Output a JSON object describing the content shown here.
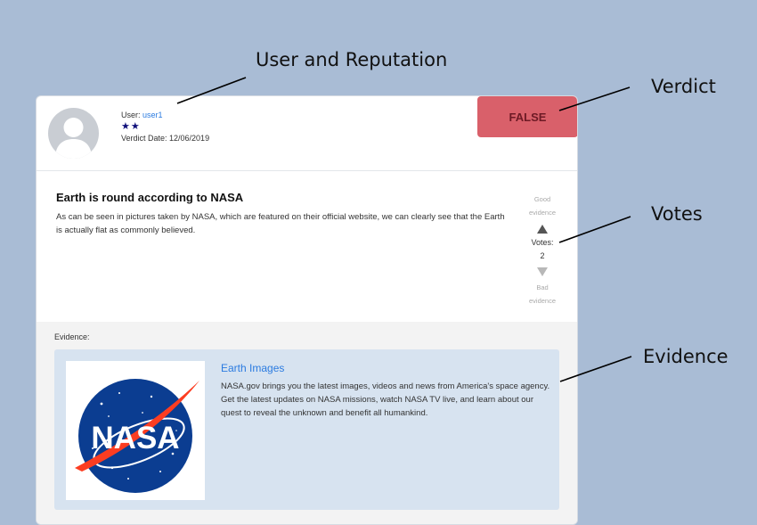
{
  "callouts": {
    "user_reputation": "User and Reputation",
    "verdict": "Verdict",
    "votes": "Votes",
    "evidence": "Evidence"
  },
  "header": {
    "user_label": "User:",
    "username": "user1",
    "stars": "★★",
    "verdict_date": "Verdict Date: 12/06/2019",
    "verdict": "FALSE"
  },
  "claim": {
    "title": "Earth is round according to NASA",
    "body": "As can be seen in pictures taken by NASA, which are featured on their official website, we can clearly see that the Earth is actually flat as commonly believed."
  },
  "votes": {
    "good_line1": "Good",
    "good_line2": "evidence",
    "label": "Votes:",
    "count": "2",
    "bad_line1": "Bad",
    "bad_line2": "evidence"
  },
  "evidence": {
    "label": "Evidence:",
    "title": "Earth Images",
    "description": "NASA.gov brings you the latest images, videos and news from America's space agency. Get the latest updates on NASA missions, watch NASA TV live, and learn about our quest to reveal the unknown and benefit all humankind.",
    "logo_text": "NASA"
  },
  "colors": {
    "page_bg": "#a9bcd5",
    "verdict_bg": "#d9606a",
    "link": "#2b7be0",
    "evidence_bg": "#d7e3f0",
    "nasa_blue": "#0b3d91",
    "nasa_red": "#fc3d21"
  }
}
